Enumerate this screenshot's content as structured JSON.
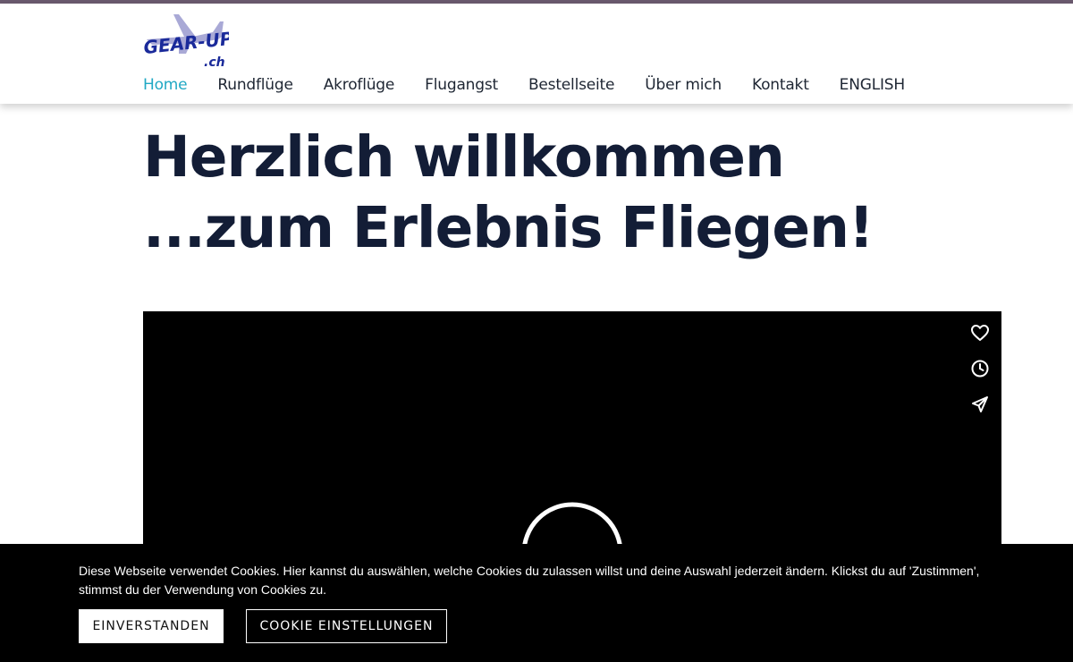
{
  "brand": {
    "logo_text": "GEAR-UP",
    "logo_suffix": ".ch",
    "accent_color": "#20a8c4",
    "logo_color": "#1a2a9a",
    "heading_color": "#131d36"
  },
  "nav": {
    "items": [
      {
        "label": "Home",
        "active": true
      },
      {
        "label": "Rundflüge"
      },
      {
        "label": "Akroflüge"
      },
      {
        "label": "Flugangst"
      },
      {
        "label": "Bestellseite"
      },
      {
        "label": "Über mich"
      },
      {
        "label": "Kontakt"
      },
      {
        "label": "ENGLISH"
      }
    ]
  },
  "hero": {
    "line1": "Herzlich willkommen",
    "line2": "...zum Erlebnis Fliegen!"
  },
  "video": {
    "icons": [
      "heart-icon",
      "clock-icon",
      "send-icon"
    ]
  },
  "cookie": {
    "text": "Diese Webseite verwendet Cookies. Hier kannst du auswählen, welche Cookies du zulassen willst und deine Auswahl jederzeit ändern. Klickst du auf 'Zustimmen', stimmst du der Verwendung von Cookies zu.",
    "accept_label": "EINVERSTANDEN",
    "settings_label": "COOKIE EINSTELLUNGEN"
  }
}
